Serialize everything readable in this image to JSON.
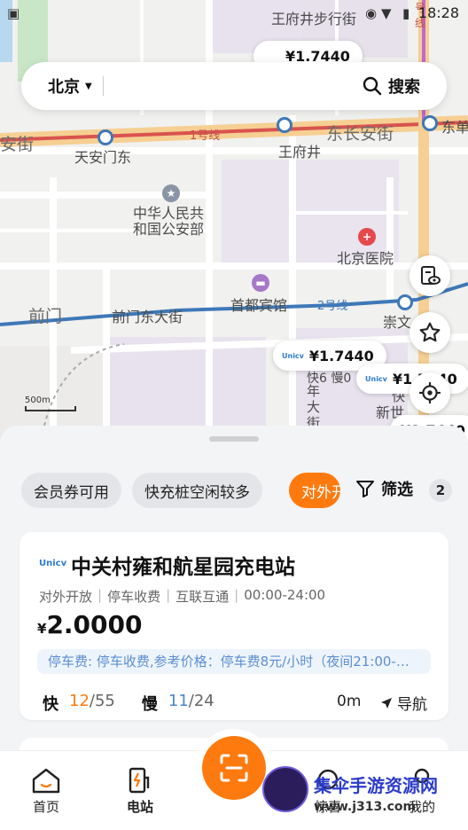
{
  "status_bar": {
    "time": "18:28"
  },
  "search_bar": {
    "city": "北京",
    "search_label": "搜索"
  },
  "map": {
    "labels": {
      "wangfujing_street": "王府井步行街",
      "tiananmen_east": "天安门东",
      "changan_west": "安街",
      "changan_east": "东长安街",
      "wangfujing": "王府井",
      "dongdan": "东单",
      "ministry": "中华人民共\n和国公安部",
      "hospital": "北京医院",
      "hotel": "首都宾馆",
      "qianmen": "前门",
      "qianmen_east": "前门东大街",
      "chongwen": "崇文",
      "line1": "1号线",
      "line2": "2号线",
      "line_vertical": "号\n线",
      "xinshijie": "新世",
      "kuai6_man0": "快6 慢0",
      "vertical_street": "年\n大\n街",
      "kuai_partial": "快"
    },
    "price_bubbles": [
      "¥1.7440",
      "¥1.7440",
      "¥1.7440",
      "¥1.7440"
    ],
    "brand": "Unicv",
    "scale": "500m"
  },
  "filters": {
    "chips": [
      "会员券可用",
      "快充桩空闲较多",
      "对外开放"
    ],
    "filter_label": "筛选",
    "filter_count": "2"
  },
  "station": {
    "brand": "Unicv",
    "name": "中关村雍和航星园充电站",
    "tags": [
      "对外开放",
      "停车收费",
      "互联互通",
      "00:00-24:00"
    ],
    "currency": "¥",
    "price": "2.0000",
    "notice": "停车费: 停车收费,参考价格：停车费8元/小时（夜间21:00-…",
    "fast_label": "快",
    "fast_free": "12",
    "fast_total": "/55",
    "slow_label": "慢",
    "slow_free": "11",
    "slow_total": "/24",
    "distance": "0m",
    "nav_label": "导航"
  },
  "tabbar": {
    "home": "首页",
    "station": "电站",
    "surprise": "惊喜",
    "mine": "我的"
  },
  "watermark": {
    "title": "集伞手游资源网",
    "url": "www.j313.com"
  },
  "colors": {
    "accent": "#ff7a0e",
    "slow_blue": "#4a86d6",
    "notice_bg": "#eef4fb"
  }
}
